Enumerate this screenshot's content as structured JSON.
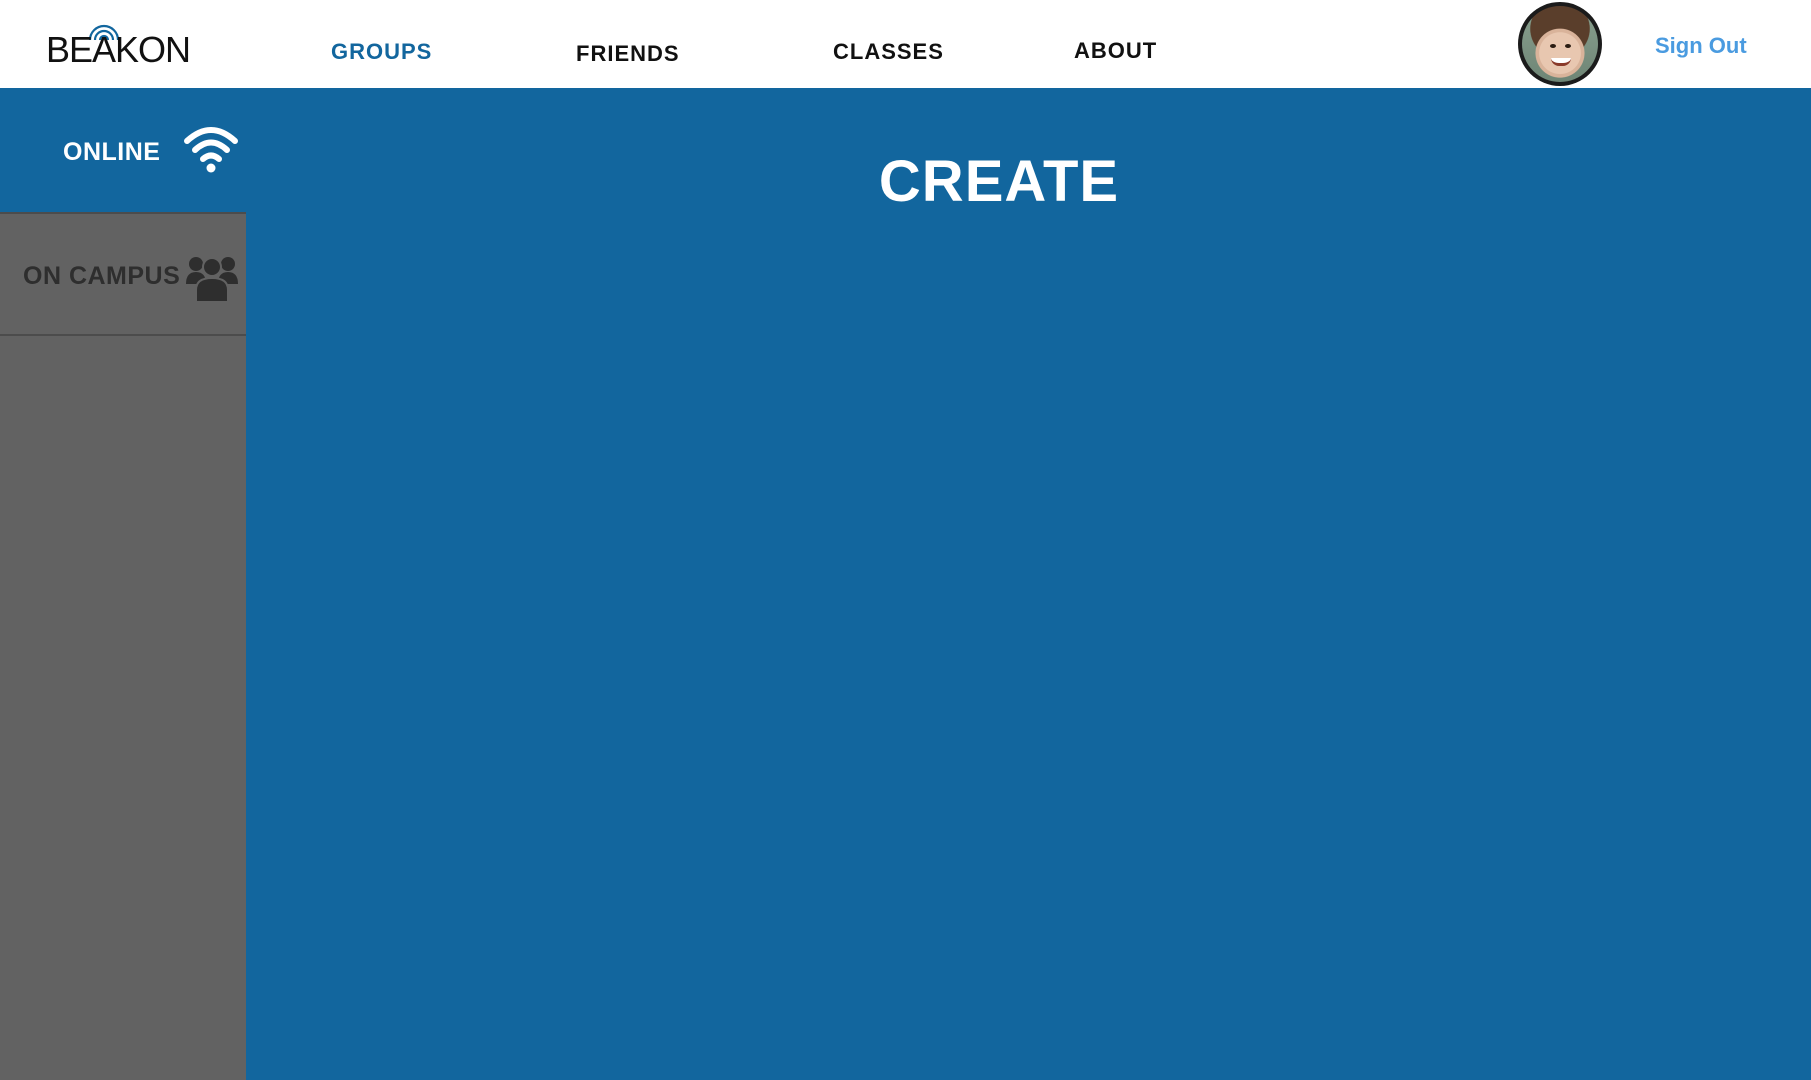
{
  "header": {
    "logo_text": "BEAKON",
    "nav": [
      {
        "label": "GROUPS",
        "active": true
      },
      {
        "label": "FRIENDS",
        "active": false
      },
      {
        "label": "CLASSES",
        "active": false
      },
      {
        "label": "ABOUT",
        "active": false
      }
    ],
    "signout_label": "Sign Out"
  },
  "sidebar": {
    "items": [
      {
        "label": "ONLINE",
        "icon": "wifi-icon",
        "selected": true
      },
      {
        "label": "ON CAMPUS",
        "icon": "people-icon",
        "selected": false
      }
    ]
  },
  "main": {
    "title": "CREATE"
  },
  "colors": {
    "primary": "#12669e",
    "sidebar_bg": "#626262",
    "signout": "#4a9be0",
    "text_dark": "#111111",
    "white": "#ffffff"
  }
}
